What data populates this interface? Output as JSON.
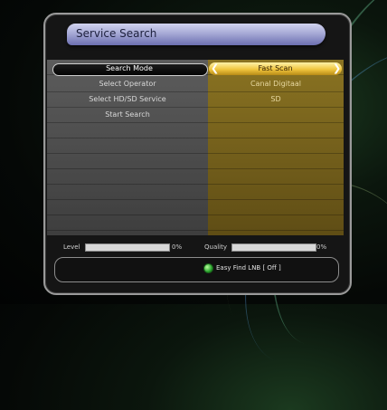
{
  "window": {
    "title": "Service Search"
  },
  "menu": {
    "rows": [
      {
        "label": "Search Mode",
        "value": "Fast Scan",
        "selected": true
      },
      {
        "label": "Select Operator",
        "value": "Canal Digitaal",
        "selected": false
      },
      {
        "label": "Select HD/SD Service",
        "value": "SD",
        "selected": false
      },
      {
        "label": "Start Search",
        "value": "",
        "selected": false
      }
    ]
  },
  "signal": {
    "level_label": "Level",
    "level_value": 0,
    "level_text": "0%",
    "quality_label": "Quality",
    "quality_value": 0,
    "quality_text": "0%"
  },
  "easy_find": {
    "label": "Easy Find LNB [ Off ]"
  },
  "colors": {
    "accent_gold": "#f0c53e",
    "title_purple": "#a7aad6",
    "indicator_green": "#2aa52f"
  },
  "icons": {
    "left_arrow": "chevron-left-icon",
    "right_arrow": "chevron-right-icon",
    "status_led": "green-dot-icon"
  }
}
